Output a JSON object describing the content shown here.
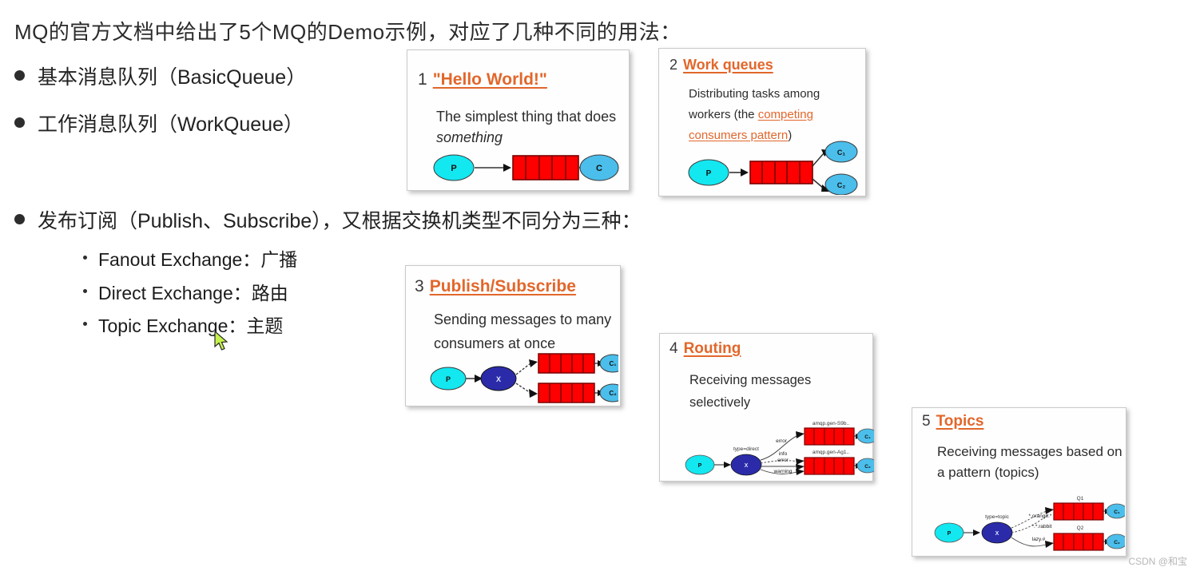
{
  "slide": {
    "title": "MQ的官方文档中给出了5个MQ的Demo示例，对应了几种不同的用法：",
    "bullets": [
      {
        "text": "基本消息队列（BasicQueue）"
      },
      {
        "text": "工作消息队列（WorkQueue）"
      },
      {
        "text": "发布订阅（Publish、Subscribe），又根据交换机类型不同分为三种："
      }
    ],
    "sub_bullets": [
      {
        "text": "Fanout Exchange：广播"
      },
      {
        "text": "Direct Exchange：路由"
      },
      {
        "text": "Topic Exchange：主题"
      }
    ]
  },
  "cards": [
    {
      "number": "1",
      "title": "\"Hello World!\"",
      "desc_plain": "The simplest thing that does ",
      "desc_italic": "something",
      "diagram": {
        "producer": "P",
        "consumers": [
          "C"
        ],
        "queues": 1
      }
    },
    {
      "number": "2",
      "title": "Work queues",
      "desc_part1": "Distributing tasks among workers (the ",
      "desc_link": "competing consumers pattern",
      "desc_part2": ")",
      "diagram": {
        "producer": "P",
        "consumers": [
          "C₁",
          "C₂"
        ],
        "queues": 1
      }
    },
    {
      "number": "3",
      "title": "Publish/Subscribe",
      "desc_plain": "Sending messages to many consumers at once",
      "diagram": {
        "producer": "P",
        "exchange": "X",
        "consumers": [
          "C₁",
          "C₂"
        ],
        "queues": 2
      }
    },
    {
      "number": "4",
      "title": "Routing",
      "desc_plain": "Receiving messages selectively",
      "diagram": {
        "producer": "P",
        "exchange": "X",
        "exchange_type": "type=direct",
        "queue_labels": [
          "amqp.gen-S9b..",
          "amqp.gen-Ag1.."
        ],
        "binding_keys": [
          "error",
          "info",
          "error",
          "warning"
        ],
        "consumers": [
          "C₁",
          "C₂"
        ],
        "queues": 2
      }
    },
    {
      "number": "5",
      "title": "Topics",
      "desc_plain": "Receiving messages based on a pattern (topics)",
      "diagram": {
        "producer": "P",
        "exchange": "X",
        "exchange_type": "type=topic",
        "queue_labels": [
          "Q1",
          "Q2"
        ],
        "binding_keys": [
          "*.orange.*",
          "*.*.rabbit",
          "lazy.#"
        ],
        "consumers": [
          "C₁",
          "C₂"
        ],
        "queues": 2
      }
    }
  ],
  "colors": {
    "accent_orange": "#E2672B",
    "producer_cyan": "#13E7F0",
    "consumer_blue": "#4BBEEB",
    "exchange_navy": "#2B2BAA",
    "queue_red": "#FF0000",
    "queue_border": "#8B0000",
    "text_dark": "#2b2b2b",
    "cursor_green": "#C6F24B"
  },
  "watermark": "CSDN @和宝"
}
